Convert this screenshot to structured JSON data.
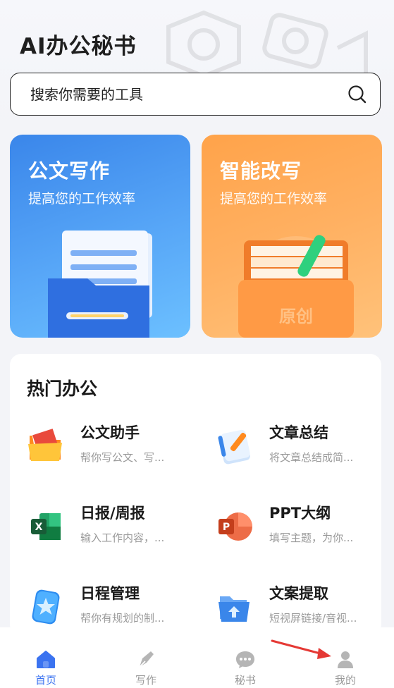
{
  "app": {
    "title": "AI办公秘书"
  },
  "search": {
    "placeholder": "搜索你需要的工具"
  },
  "cards": [
    {
      "title": "公文写作",
      "subtitle": "提高您的工作效率",
      "color": "#3a86ea"
    },
    {
      "title": "智能改写",
      "subtitle": "提高您的工作效率",
      "color": "#ffa34a",
      "art_text": "原创"
    }
  ],
  "hot": {
    "title": "热门办公",
    "tools": [
      {
        "name": "公文助手",
        "desc": "帮你写公文、写...",
        "icon": "folder-icon"
      },
      {
        "name": "文章总结",
        "desc": "将文章总结成简...",
        "icon": "notebook-icon"
      },
      {
        "name": "日报/周报",
        "desc": "输入工作内容，...",
        "icon": "excel-icon"
      },
      {
        "name": "PPT大纲",
        "desc": "填写主题，为你...",
        "icon": "powerpoint-icon"
      },
      {
        "name": "日程管理",
        "desc": "帮你有规划的制...",
        "icon": "star-card-icon"
      },
      {
        "name": "文案提取",
        "desc": "短视屏链接/音视...",
        "icon": "upload-folder-icon"
      }
    ]
  },
  "tabbar": {
    "items": [
      {
        "label": "首页",
        "icon": "home-icon",
        "active": true
      },
      {
        "label": "写作",
        "icon": "pen-icon",
        "active": false
      },
      {
        "label": "秘书",
        "icon": "chat-icon",
        "active": false
      },
      {
        "label": "我的",
        "icon": "user-icon",
        "active": false
      }
    ]
  },
  "colors": {
    "accent": "#3b73f0",
    "arrow": "#e53935"
  }
}
